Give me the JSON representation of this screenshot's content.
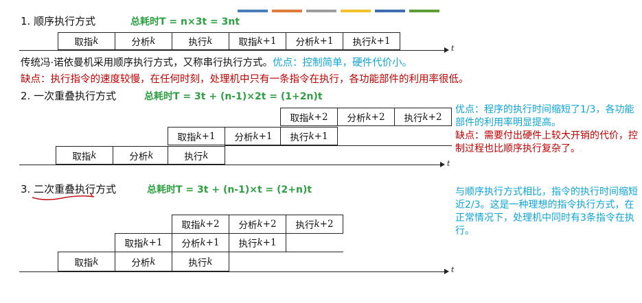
{
  "colors": {
    "stripes": [
      "#4a7ebb",
      "#e07b39",
      "#9e9e9e",
      "#f2c12e",
      "#3e6fb3",
      "#5e9e3a"
    ],
    "formula": "#2ea043",
    "red": "#c00000",
    "blue": "#0ea5d4"
  },
  "sections": [
    {
      "title": "1. 顺序执行方式",
      "formula": "总耗时T = n×3t = 3nt",
      "rows": [
        [
          "取指k",
          "分析k",
          "执行k",
          "取指k+1",
          "分析k+1",
          "执行k+1"
        ]
      ],
      "axis_label": "t"
    },
    {
      "title": "2. 一次重叠执行方式",
      "formula": "总耗时T = 3t + (n-1)×2t = (1+2n)t",
      "rows": [
        [
          "取指k+2",
          "分析k+2",
          "执行k+2"
        ],
        [
          "取指k+1",
          "分析k+1",
          "执行k+1"
        ],
        [
          "取指k",
          "分析k",
          "执行k"
        ]
      ],
      "axis_label": "t"
    },
    {
      "title_prefix": "3. ",
      "title_underlined": "二次重叠",
      "title_rest": "执行方式",
      "formula": "总耗时T = 3t + (n-1)×t = (2+n)t",
      "rows": [
        [
          "取指k+2",
          "分析k+2",
          "执行k+2"
        ],
        [
          "取指k+1",
          "分析k+1",
          "执行k+1"
        ],
        [
          "取指k",
          "分析k",
          "执行k"
        ]
      ],
      "axis_label": "t"
    }
  ],
  "text": {
    "seq_desc_black": "传统冯·诺依曼机采用顺序执行方式，又称串行执行方式。",
    "seq_desc_blue": "优点：控制简单，硬件代价小。",
    "seq_cons": "缺点：执行指令的速度较慢，在任何时刻，处理机中只有一条指令在执行，各功能部件的利用率很低。",
    "overlap1_pros": "优点：程序的执行时间缩短了1/3，各功能部件的利用率明显提高。",
    "overlap1_cons": "缺点：需要付出硬件上较大开销的代价，控制过程也比顺序执行复杂了。",
    "overlap2_note": "与顺序执行方式相比，指令的执行时间缩短近2/3。这是一种理想的指令执行方式，在正常情况下，处理机中同时有3条指令在执行。"
  }
}
